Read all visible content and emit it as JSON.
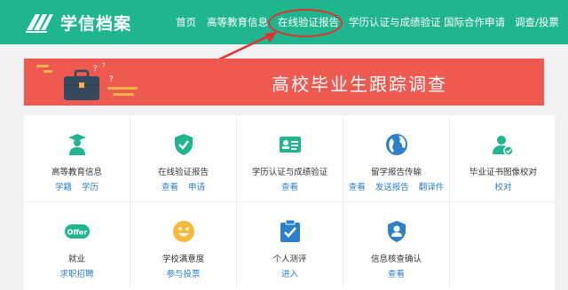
{
  "brand": {
    "name": "学信档案"
  },
  "nav": {
    "items": [
      {
        "label": "首页"
      },
      {
        "label": "高等教育信息"
      },
      {
        "label": "在线验证报告",
        "highlighted": true
      },
      {
        "label": "学历认证与成绩验证"
      },
      {
        "label": "国际合作申请"
      },
      {
        "label": "调查/投票"
      }
    ]
  },
  "banner": {
    "title": "高校毕业生跟踪调查"
  },
  "services": [
    {
      "title": "高等教育信息",
      "icon": "graduate-icon",
      "links": [
        "学籍",
        "学历"
      ]
    },
    {
      "title": "在线验证报告",
      "icon": "shield-check-icon",
      "links": [
        "查看",
        "申请"
      ]
    },
    {
      "title": "学历认证与成绩验证",
      "icon": "id-card-icon",
      "links": [
        "查看"
      ]
    },
    {
      "title": "留学报告传输",
      "icon": "globe-icon",
      "links": [
        "查看",
        "发送报告",
        "翻译件"
      ]
    },
    {
      "title": "毕业证书图像校对",
      "icon": "user-check-icon",
      "links": [
        "校对"
      ]
    },
    {
      "title": "就业",
      "icon": "offer-icon",
      "links": [
        "求职招聘"
      ]
    },
    {
      "title": "学校满意度",
      "icon": "smile-icon",
      "links": [
        "参与投票"
      ]
    },
    {
      "title": "个人测评",
      "icon": "checklist-icon",
      "links": [
        "进入"
      ]
    },
    {
      "title": "信息核查确认",
      "icon": "shield-user-icon",
      "links": [
        "查看"
      ]
    }
  ],
  "colors": {
    "brand": "#1fb58e",
    "banner": "#ef5a50",
    "link": "#2d7fcc",
    "highlight": "#e53030"
  }
}
